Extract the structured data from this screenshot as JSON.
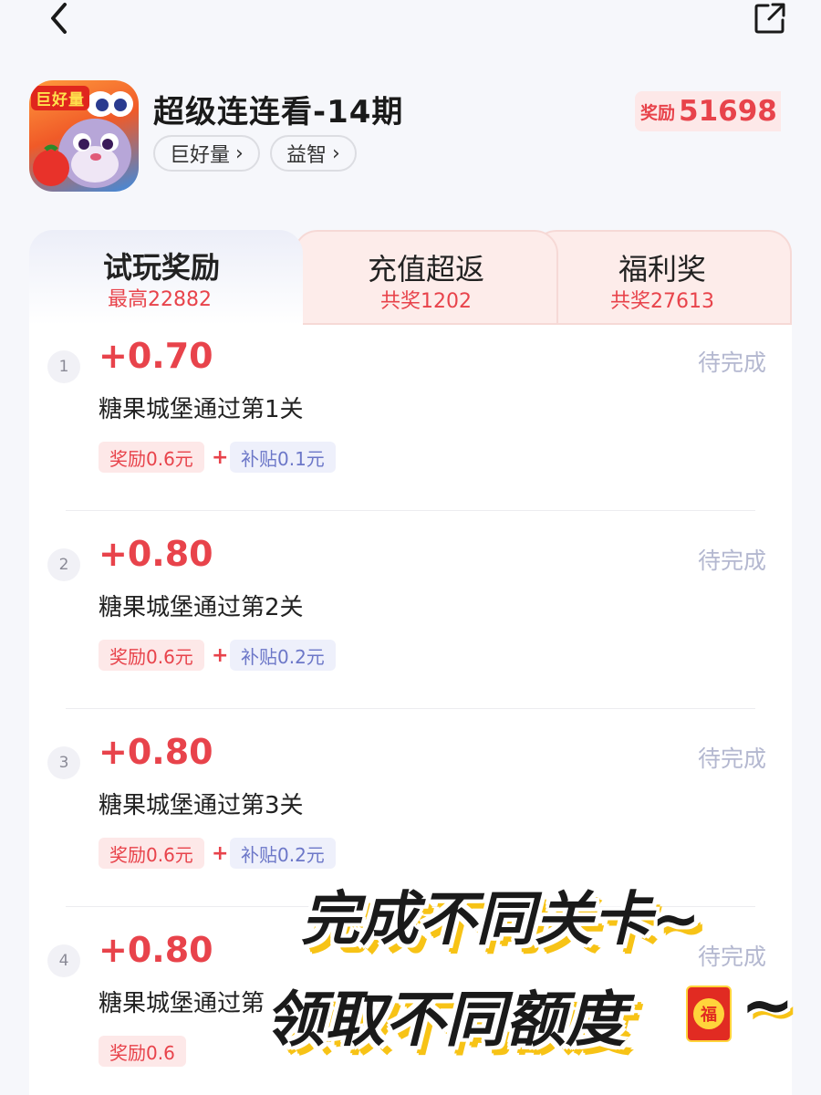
{
  "topbar": {
    "back_icon": "chevron-left-icon",
    "share_icon": "share-external-icon"
  },
  "game": {
    "icon_badge": "巨好量",
    "title": "超级连连看-14期",
    "tags": [
      {
        "label": "巨好量",
        "arrow": "›"
      },
      {
        "label": "益智",
        "arrow": "›"
      }
    ],
    "reward": {
      "label": "奖励",
      "amount": "51698"
    }
  },
  "tabs": [
    {
      "title": "试玩奖励",
      "sub": "最高22882"
    },
    {
      "title": "充值超返",
      "sub": "共奖1202"
    },
    {
      "title": "福利奖",
      "sub": "共奖27613"
    }
  ],
  "tasks": [
    {
      "num": "1",
      "amount": "+0.70",
      "status": "待完成",
      "name": "糖果城堡通过第1关",
      "reward": "奖励0.6元",
      "plus": "+",
      "subsidy": "补贴0.1元"
    },
    {
      "num": "2",
      "amount": "+0.80",
      "status": "待完成",
      "name": "糖果城堡通过第2关",
      "reward": "奖励0.6元",
      "plus": "+",
      "subsidy": "补贴0.2元"
    },
    {
      "num": "3",
      "amount": "+0.80",
      "status": "待完成",
      "name": "糖果城堡通过第3关",
      "reward": "奖励0.6元",
      "plus": "+",
      "subsidy": "补贴0.2元"
    },
    {
      "num": "4",
      "amount": "+0.80",
      "status": "待完成",
      "name": "糖果城堡通过第",
      "reward": "奖励0.6",
      "plus": "",
      "subsidy": ""
    }
  ],
  "overlay": {
    "line1": "完成不同关卡~",
    "line2": "领取不同额度",
    "redpacket_char": "福",
    "tilde": "~"
  },
  "colors": {
    "accent_red": "#e8434b",
    "status_gray": "#b4b8d0",
    "subsidy_blue": "#6c77c8",
    "highlight_yellow": "#f7c316"
  }
}
